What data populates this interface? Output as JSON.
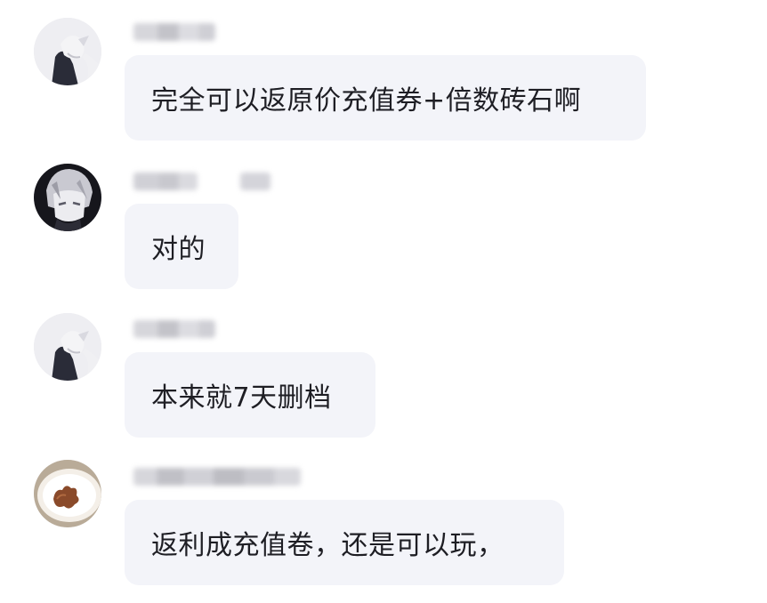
{
  "messages": [
    {
      "sender": "",
      "avatar": "avatar-icon",
      "text": "完全可以返原价充值券+倍数砖石啊"
    },
    {
      "sender": "",
      "avatar": "avatar-icon",
      "text": "对的"
    },
    {
      "sender": "",
      "avatar": "avatar-icon",
      "text": "本来就7天删档"
    },
    {
      "sender": "",
      "avatar": "avatar-icon",
      "text": "返利成充值卷，还是可以玩，"
    }
  ],
  "colors": {
    "bubble": "#f3f4f9",
    "text": "#1e1e24",
    "background": "#ffffff"
  }
}
